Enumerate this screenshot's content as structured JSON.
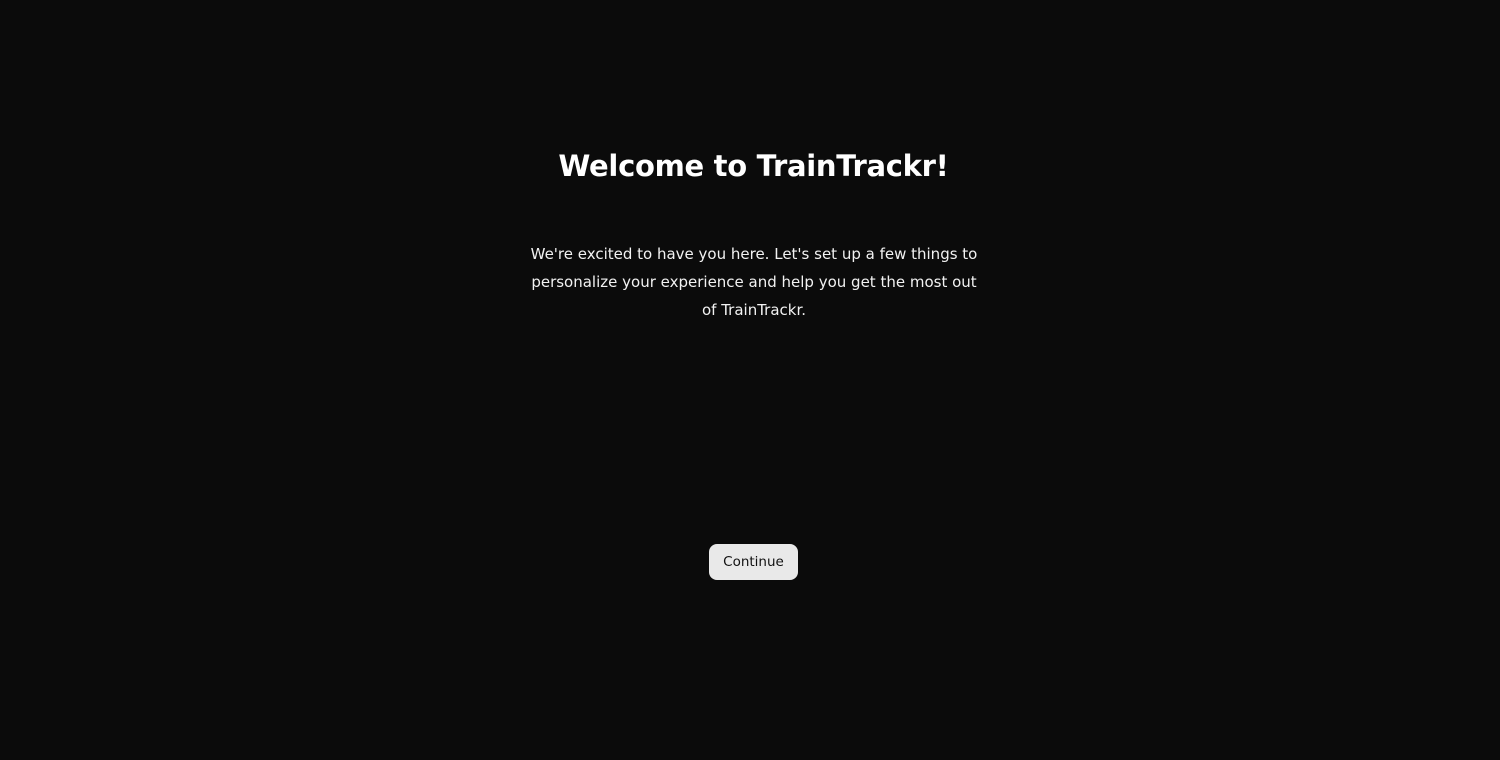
{
  "onboarding": {
    "title": "Welcome to TrainTrackr!",
    "message": "We're excited to have you here. Let's set up a few things to personalize your experience and help you get the most out of TrainTrackr.",
    "continue_label": "Continue"
  },
  "colors": {
    "background": "#0b0b0b",
    "text": "#ffffff",
    "button_background": "#e9e9e9",
    "button_text": "#111111"
  }
}
